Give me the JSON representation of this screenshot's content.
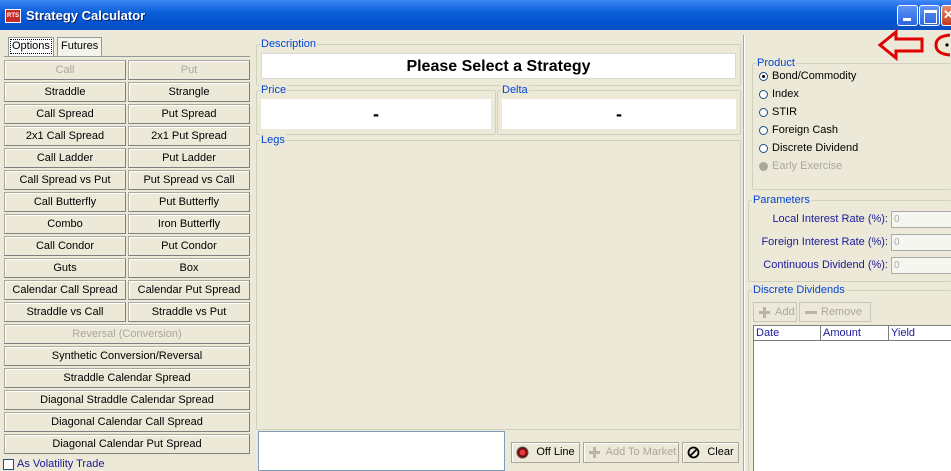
{
  "window": {
    "title": "Strategy Calculator",
    "app_icon_text": "RTS"
  },
  "tabs": [
    "Options",
    "Futures"
  ],
  "strategies": {
    "pairs": [
      [
        "Call",
        "Put"
      ],
      [
        "Straddle",
        "Strangle"
      ],
      [
        "Call Spread",
        "Put Spread"
      ],
      [
        "2x1 Call Spread",
        "2x1 Put Spread"
      ],
      [
        "Call Ladder",
        "Put Ladder"
      ],
      [
        "Call Spread vs Put",
        "Put Spread vs Call"
      ],
      [
        "Call Butterfly",
        "Put Butterfly"
      ],
      [
        "Combo",
        "Iron Butterfly"
      ],
      [
        "Call Condor",
        "Put Condor"
      ],
      [
        "Guts",
        "Box"
      ],
      [
        "Calendar Call Spread",
        "Calendar Put Spread"
      ],
      [
        "Straddle vs Call",
        "Straddle vs Put"
      ]
    ],
    "singles": [
      "Reversal (Conversion)",
      "Synthetic Conversion/Reversal",
      "Straddle Calendar Spread",
      "Diagonal Straddle Calendar Spread",
      "Diagonal Calendar Call Spread",
      "Diagonal Calendar Put Spread"
    ]
  },
  "volatility_trade_label": "As Volatility Trade",
  "description": {
    "label": "Description",
    "value": "Please Select a Strategy"
  },
  "price": {
    "label": "Price",
    "value": "-"
  },
  "delta": {
    "label": "Delta",
    "value": "-"
  },
  "legs": {
    "label": "Legs"
  },
  "bottom_buttons": {
    "offline": "Off Line",
    "add_to_market": "Add To Market",
    "clear": "Clear"
  },
  "product": {
    "label": "Product",
    "options": [
      "Bond/Commodity",
      "Index",
      "STIR",
      "Foreign Cash",
      "Discrete Dividend"
    ],
    "selected": "Bond/Commodity",
    "early_exercise": "Early Exercise"
  },
  "parameters": {
    "label": "Parameters",
    "fields": [
      {
        "label": "Local Interest Rate (%):",
        "value": "0"
      },
      {
        "label": "Foreign Interest Rate (%):",
        "value": "0"
      },
      {
        "label": "Continuous Dividend (%):",
        "value": "0"
      }
    ]
  },
  "discrete_dividends": {
    "label": "Discrete Dividends",
    "add": "Add",
    "remove": "Remove",
    "columns": [
      "Date",
      "Amount",
      "Yield"
    ]
  },
  "colors": {
    "accent": "#0046d5",
    "titlebar": "#0554d1",
    "annotation": "#e00000"
  }
}
